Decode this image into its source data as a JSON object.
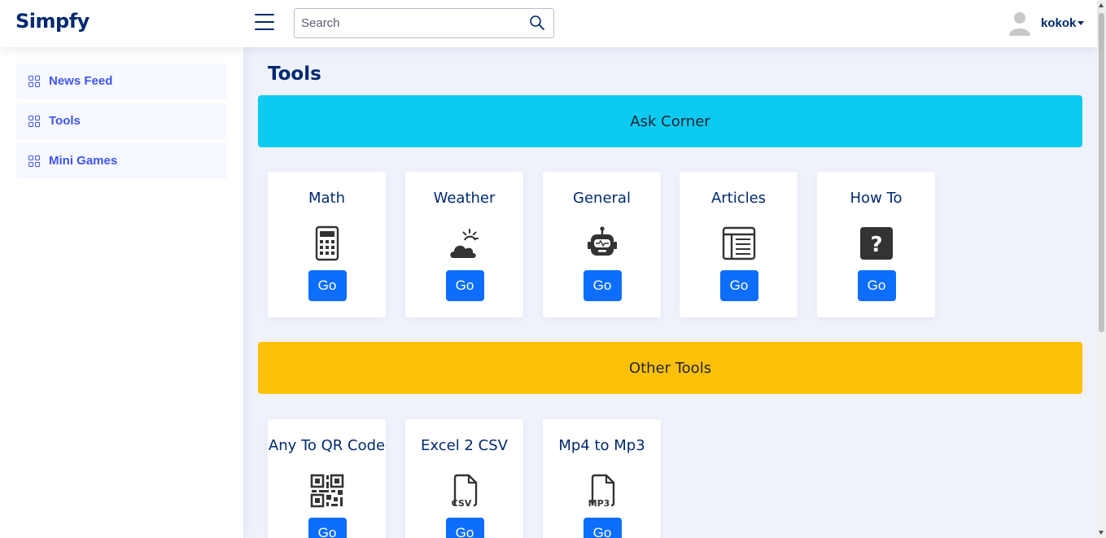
{
  "header": {
    "logo": "Simpfy",
    "search_placeholder": "Search",
    "username": "kokok"
  },
  "sidebar": {
    "items": [
      {
        "label": "News Feed"
      },
      {
        "label": "Tools"
      },
      {
        "label": "Mini Games"
      }
    ]
  },
  "main": {
    "page_title": "Tools",
    "sections": [
      {
        "title": "Ask Corner",
        "color": "#0dcaf0",
        "cards": [
          {
            "title": "Math",
            "icon": "calculator-icon",
            "button": "Go"
          },
          {
            "title": "Weather",
            "icon": "cloud-sun-icon",
            "button": "Go"
          },
          {
            "title": "General",
            "icon": "robot-icon",
            "button": "Go"
          },
          {
            "title": "Articles",
            "icon": "newspaper-icon",
            "button": "Go"
          },
          {
            "title": "How To",
            "icon": "question-square-icon",
            "button": "Go"
          }
        ]
      },
      {
        "title": "Other Tools",
        "color": "#ffc107",
        "cards": [
          {
            "title": "Any To QR Code",
            "icon": "qr-code-icon",
            "button": "Go"
          },
          {
            "title": "Excel 2 CSV",
            "icon": "csv-file-icon",
            "button": "Go",
            "icon_text": "CSV"
          },
          {
            "title": "Mp4 to Mp3",
            "icon": "mp3-file-icon",
            "button": "Go",
            "icon_text": "MP3"
          }
        ]
      }
    ]
  },
  "colors": {
    "brand": "#012970",
    "accent": "#4154f1",
    "button": "#0d6efd",
    "background": "#f0f2fb"
  }
}
